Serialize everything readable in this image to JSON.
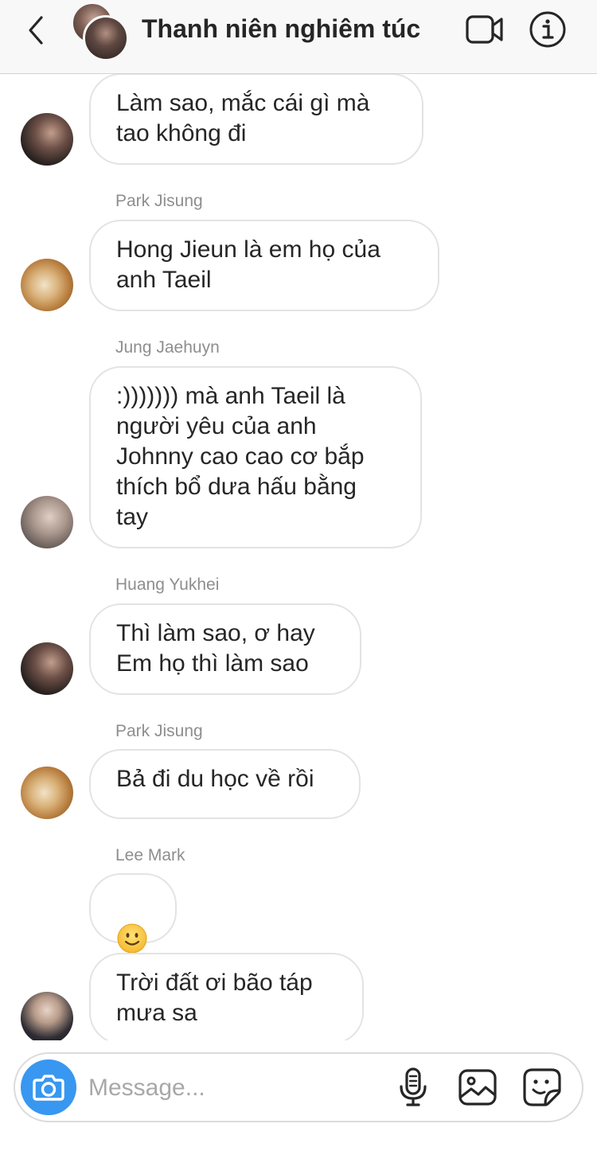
{
  "header": {
    "title": "Thanh niên nghiêm túc",
    "back_icon": "chevron-left-icon",
    "video_icon": "video-camera-icon",
    "info_icon": "info-icon"
  },
  "messages": [
    {
      "sender": "",
      "text": "Làm sao, mắc cái gì mà\ntao không đi"
    },
    {
      "sender": "Park Jisung",
      "text": "Hong Jieun là em họ của\nanh Taeil"
    },
    {
      "sender": "Jung Jaehuyn",
      "text": ":))))))) mà anh Taeil là\nngười yêu của anh\nJohnny cao cao cơ bắp\nthích bổ dưa hấu bằng\ntay"
    },
    {
      "sender": "Huang Yukhei",
      "text": "Thì làm sao, ơ hay\nEm họ thì làm sao"
    },
    {
      "sender": "Park Jisung",
      "text": "Bả đi du học về rồi"
    },
    {
      "sender": "Lee Mark",
      "text": "",
      "emoji": "slightly-smiling-face"
    },
    {
      "sender": "",
      "text": "Trời đất ơi bão táp\nmưa sa"
    }
  ],
  "composer": {
    "placeholder": "Message...",
    "camera_icon": "camera-icon",
    "mic_icon": "microphone-icon",
    "gallery_icon": "gallery-icon",
    "sticker_icon": "sticker-icon"
  },
  "colors": {
    "accent": "#3897f0",
    "text": "#262626",
    "secondary_text": "#8e8e8e",
    "bubble_border": "#e3e3e3",
    "header_bg": "#f8f8f8"
  }
}
